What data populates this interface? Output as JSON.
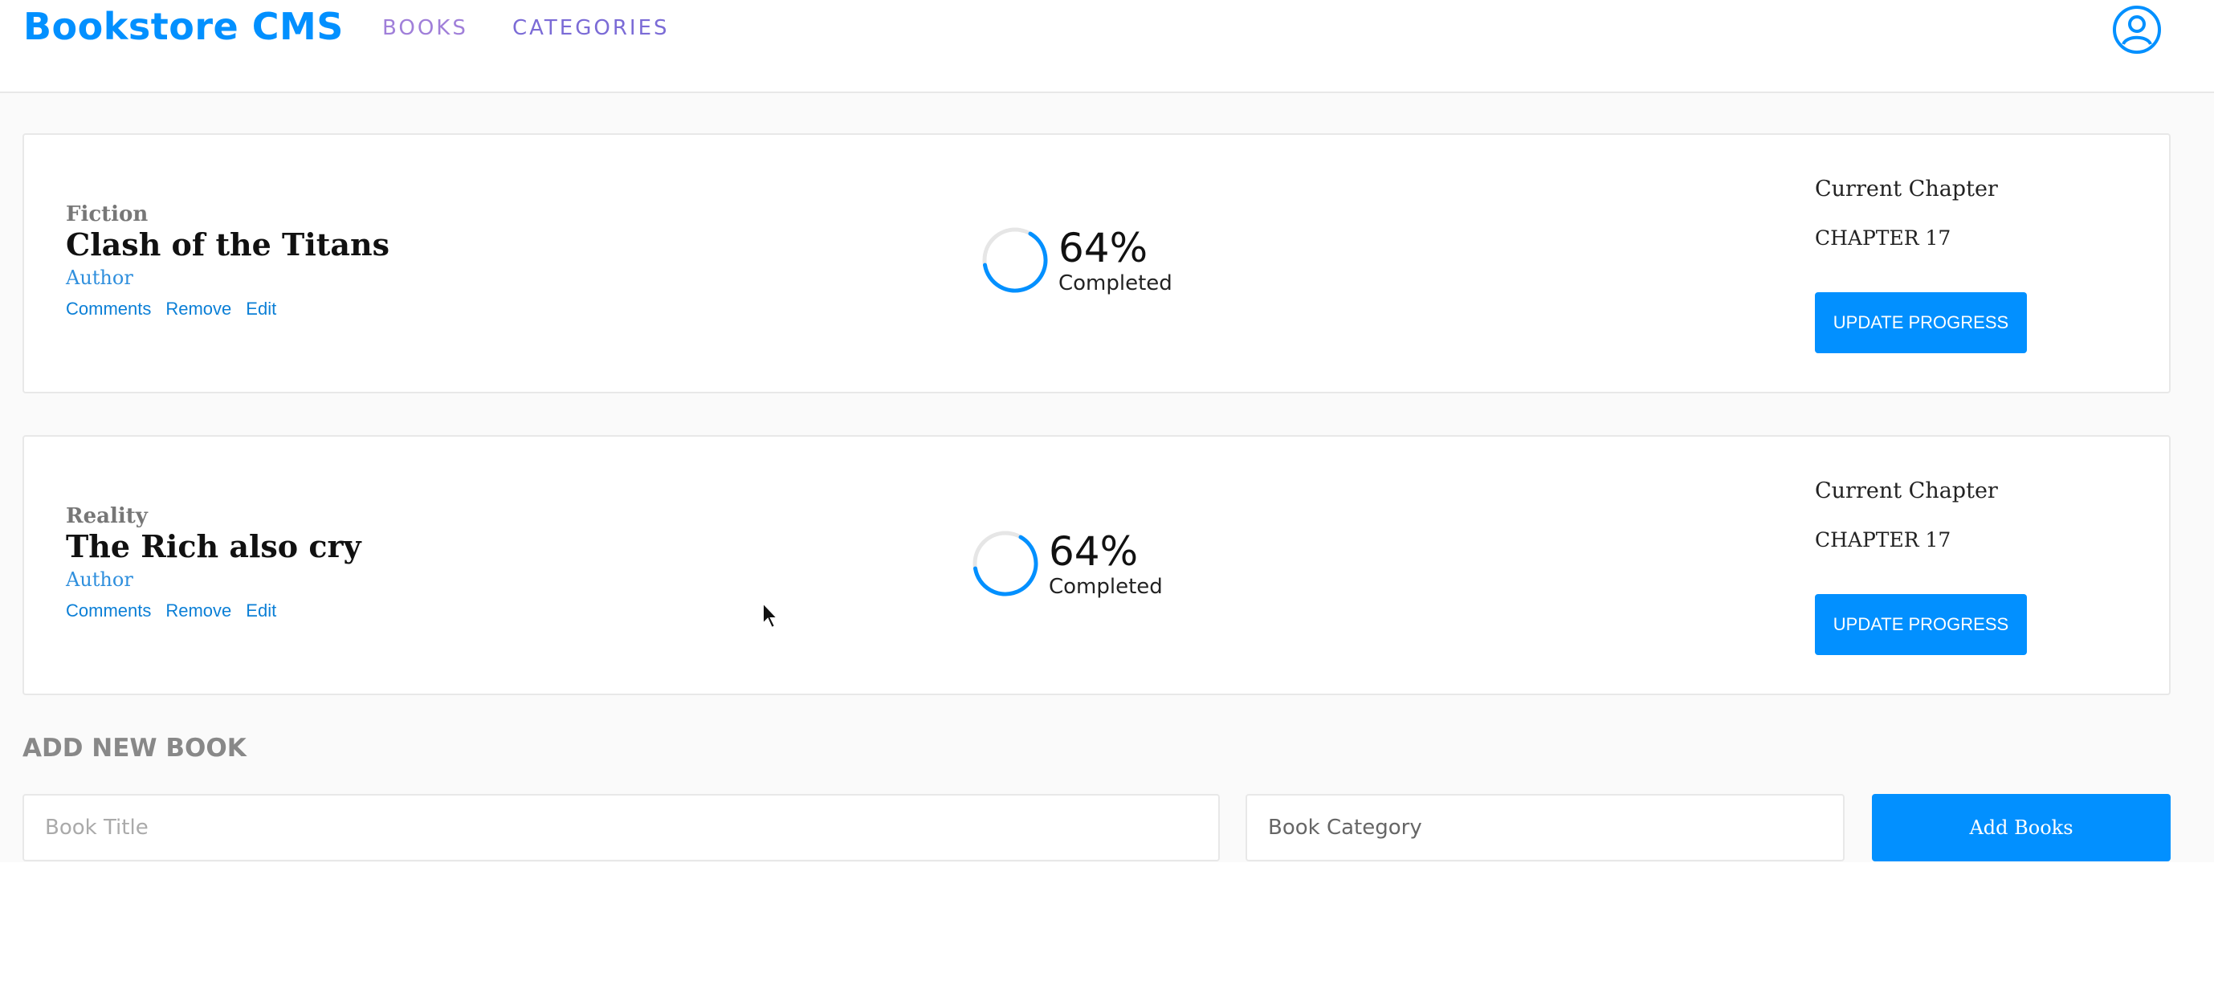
{
  "header": {
    "logo": "Bookstore CMS",
    "nav": [
      {
        "label": "BOOKS"
      },
      {
        "label": "CATEGORIES"
      }
    ],
    "user_icon": "user-circle-icon"
  },
  "books": [
    {
      "category": "Fiction",
      "title": "Clash of the Titans",
      "author": "Author",
      "actions": [
        "Comments",
        "Remove",
        "Edit"
      ],
      "progress_percent": 64,
      "progress_label": "64%",
      "completed_label": "Completed",
      "chapter_label": "Current Chapter",
      "chapter_value": "CHAPTER 17",
      "update_label": "UPDATE PROGRESS"
    },
    {
      "category": "Reality",
      "title": "The Rich also cry",
      "author": "Author",
      "actions": [
        "Comments",
        "Remove",
        "Edit"
      ],
      "progress_percent": 64,
      "progress_label": "64%",
      "completed_label": "Completed",
      "chapter_label": "Current Chapter",
      "chapter_value": "CHAPTER 17",
      "update_label": "UPDATE PROGRESS"
    }
  ],
  "add_book": {
    "heading": "ADD NEW BOOK",
    "title_placeholder": "Book Title",
    "category_value": "Book Category",
    "submit_label": "Add Books"
  },
  "colors": {
    "accent": "#0290ff",
    "nav": "#a07fd9",
    "progress_track": "#e6e6e6"
  }
}
